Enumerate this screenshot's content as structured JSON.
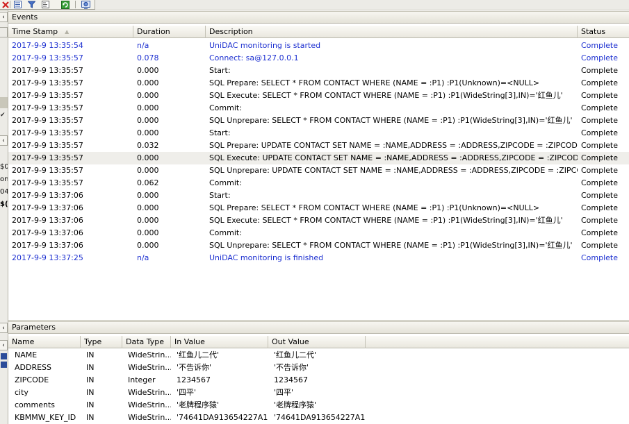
{
  "toolbar": {
    "icons": [
      "close-icon",
      "list-icon",
      "filter-icon",
      "refresh-icon",
      "monitor-icon"
    ]
  },
  "left_strip": {
    "fragments": [
      "$0",
      "on",
      "04",
      "$("
    ]
  },
  "events": {
    "title": "Events",
    "columns": [
      "Time Stamp",
      "Duration",
      "Description",
      "Status"
    ],
    "rows": [
      {
        "time": "2017-9-9 13:35:54",
        "duration": "n/a",
        "description": "UniDAC monitoring is started",
        "status": "Complete",
        "highlight": true
      },
      {
        "time": "2017-9-9 13:35:57",
        "duration": "0.078",
        "description": "Connect: sa@127.0.0.1",
        "status": "Complete",
        "highlight": true
      },
      {
        "time": "2017-9-9 13:35:57",
        "duration": "0.000",
        "description": "Start:",
        "status": "Complete"
      },
      {
        "time": "2017-9-9 13:35:57",
        "duration": "0.000",
        "description": "SQL Prepare: SELECT * FROM CONTACT WHERE (NAME = :P1)  :P1(Unknown)=<NULL>",
        "status": "Complete"
      },
      {
        "time": "2017-9-9 13:35:57",
        "duration": "0.000",
        "description": "SQL Execute: SELECT * FROM CONTACT WHERE (NAME = :P1)  :P1(WideString[3],IN)='红鱼儿'",
        "status": "Complete"
      },
      {
        "time": "2017-9-9 13:35:57",
        "duration": "0.000",
        "description": "Commit:",
        "status": "Complete"
      },
      {
        "time": "2017-9-9 13:35:57",
        "duration": "0.000",
        "description": "SQL Unprepare: SELECT * FROM CONTACT WHERE (NAME = :P1)  :P1(WideString[3],IN)='红鱼儿'",
        "status": "Complete"
      },
      {
        "time": "2017-9-9 13:35:57",
        "duration": "0.000",
        "description": "Start:",
        "status": "Complete"
      },
      {
        "time": "2017-9-9 13:35:57",
        "duration": "0.032",
        "description": "SQL Prepare: UPDATE CONTACT SET NAME = :NAME,ADDRESS = :ADDRESS,ZIPCODE = :ZIPCODE,city = :...",
        "status": "Complete"
      },
      {
        "time": "2017-9-9 13:35:57",
        "duration": "0.000",
        "description": "SQL Execute: UPDATE CONTACT SET NAME = :NAME,ADDRESS = :ADDRESS,ZIPCODE = :ZIPCODE,city = :...",
        "status": "Complete",
        "selected": true
      },
      {
        "time": "2017-9-9 13:35:57",
        "duration": "0.000",
        "description": "SQL Unprepare: UPDATE CONTACT SET NAME = :NAME,ADDRESS = :ADDRESS,ZIPCODE = :ZIPCODE,city ...",
        "status": "Complete"
      },
      {
        "time": "2017-9-9 13:35:57",
        "duration": "0.062",
        "description": "Commit:",
        "status": "Complete"
      },
      {
        "time": "2017-9-9 13:37:06",
        "duration": "0.000",
        "description": "Start:",
        "status": "Complete"
      },
      {
        "time": "2017-9-9 13:37:06",
        "duration": "0.000",
        "description": "SQL Prepare: SELECT * FROM CONTACT WHERE (NAME = :P1)  :P1(Unknown)=<NULL>",
        "status": "Complete"
      },
      {
        "time": "2017-9-9 13:37:06",
        "duration": "0.000",
        "description": "SQL Execute: SELECT * FROM CONTACT WHERE (NAME = :P1)  :P1(WideString[3],IN)='红鱼儿'",
        "status": "Complete"
      },
      {
        "time": "2017-9-9 13:37:06",
        "duration": "0.000",
        "description": "Commit:",
        "status": "Complete"
      },
      {
        "time": "2017-9-9 13:37:06",
        "duration": "0.000",
        "description": "SQL Unprepare: SELECT * FROM CONTACT WHERE (NAME = :P1)  :P1(WideString[3],IN)='红鱼儿'",
        "status": "Complete"
      },
      {
        "time": "2017-9-9 13:37:25",
        "duration": "n/a",
        "description": "UniDAC monitoring is finished",
        "status": "Complete",
        "highlight": true
      }
    ]
  },
  "parameters": {
    "title": "Parameters",
    "columns": [
      "Name",
      "Type",
      "Data Type",
      "In Value",
      "Out Value"
    ],
    "rows": [
      {
        "name": "NAME",
        "type": "IN",
        "data_type": "WideStrin...",
        "in_value": "'红鱼儿二代'",
        "out_value": "'红鱼儿二代'"
      },
      {
        "name": "ADDRESS",
        "type": "IN",
        "data_type": "WideStrin...",
        "in_value": "'不告诉你'",
        "out_value": "'不告诉你'"
      },
      {
        "name": "ZIPCODE",
        "type": "IN",
        "data_type": "Integer",
        "in_value": "1234567",
        "out_value": "1234567"
      },
      {
        "name": "city",
        "type": "IN",
        "data_type": "WideStrin...",
        "in_value": "'四平'",
        "out_value": "'四平'"
      },
      {
        "name": "comments",
        "type": "IN",
        "data_type": "WideStrin...",
        "in_value": "'老牌程序猿'",
        "out_value": "'老牌程序猿'"
      },
      {
        "name": "KBMMW_KEY_ID",
        "type": "IN",
        "data_type": "WideStrin...",
        "in_value": "'74641DA913654227A1...",
        "out_value": "'74641DA913654227A1..."
      }
    ]
  },
  "colors": {
    "highlight_text": "#1c2fd0",
    "selected_row": "#efeeea",
    "chrome": "#ecebe6"
  }
}
